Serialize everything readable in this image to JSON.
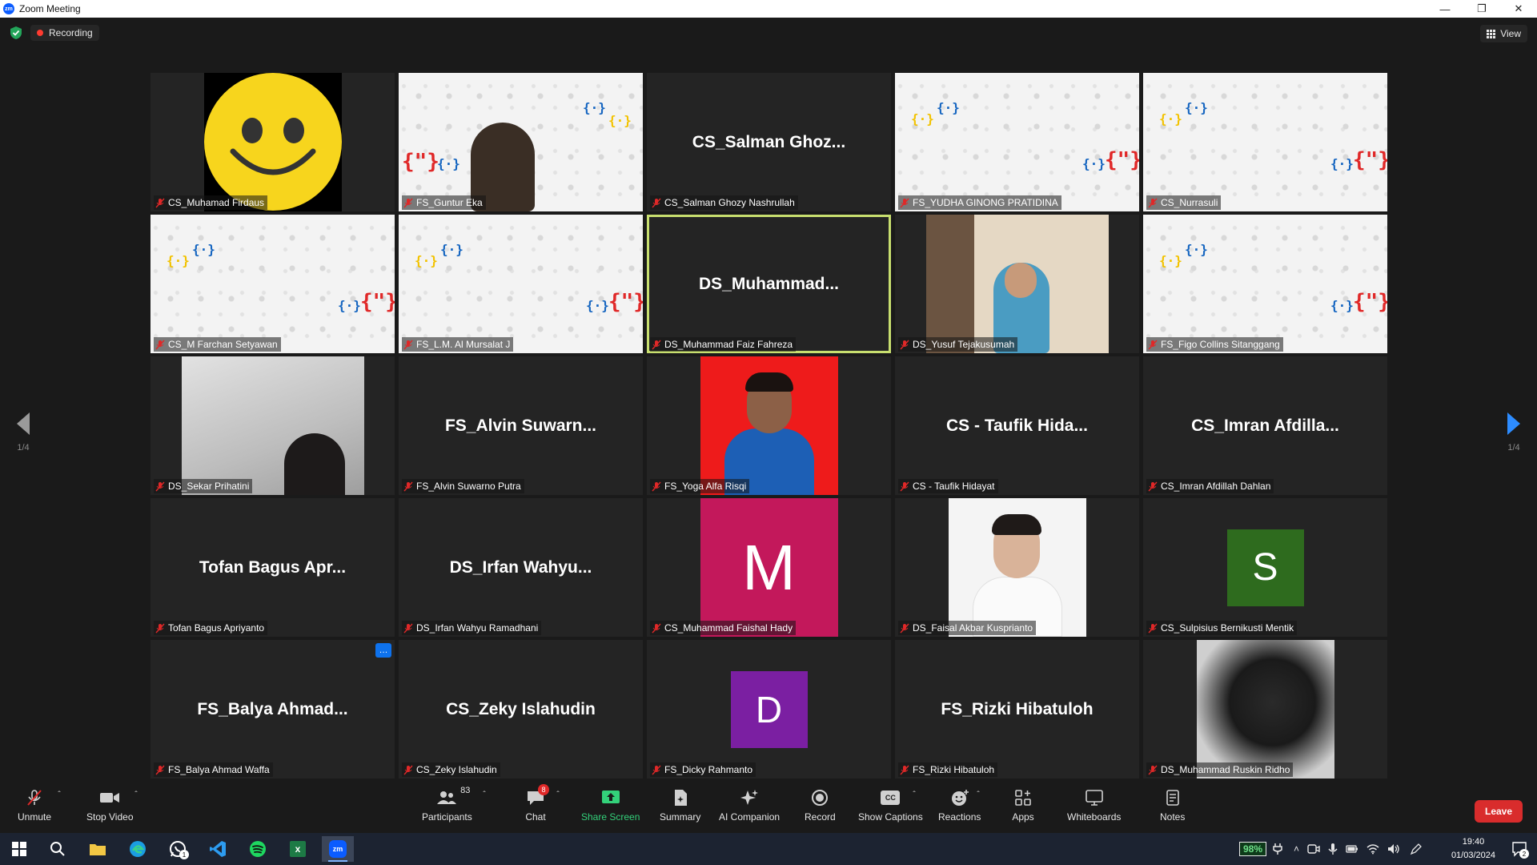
{
  "window": {
    "title": "Zoom Meeting",
    "logo_text": "zm"
  },
  "meeting": {
    "recording_label": "Recording",
    "view_label": "View",
    "page_indicator_left": "1/4",
    "page_indicator_right": "1/4"
  },
  "tiles": [
    {
      "label": "CS_Muhamad Firdaus",
      "big": ""
    },
    {
      "label": "FS_Guntur Eka",
      "big": ""
    },
    {
      "label": "CS_Salman Ghozy Nashrullah",
      "big": "CS_Salman  Ghoz..."
    },
    {
      "label": "FS_YUDHA GINONG PRATIDINA",
      "big": ""
    },
    {
      "label": "CS_Nurrasuli",
      "big": ""
    },
    {
      "label": "CS_M Farchan Setyawan",
      "big": ""
    },
    {
      "label": "FS_L.M. Al Mursalat J",
      "big": ""
    },
    {
      "label": "DS_Muhammad Faiz Fahreza",
      "big": "DS_Muhammad..."
    },
    {
      "label": "DS_Yusuf Tejakusumah",
      "big": ""
    },
    {
      "label": "FS_Figo Collins Sitanggang",
      "big": ""
    },
    {
      "label": "DS_Sekar Prihatini",
      "big": ""
    },
    {
      "label": "FS_Alvin Suwarno Putra",
      "big": "FS_Alvin  Suwarn..."
    },
    {
      "label": "FS_Yoga Alfa Risqi",
      "big": ""
    },
    {
      "label": "CS - Taufik Hidayat",
      "big": "CS - Taufik  Hida..."
    },
    {
      "label": "CS_Imran Afdillah Dahlan",
      "big": "CS_Imran  Afdilla..."
    },
    {
      "label": "Tofan Bagus Apriyanto",
      "big": "Tofan Bagus  Apr..."
    },
    {
      "label": "DS_Irfan Wahyu Ramadhani",
      "big": "DS_Irfan  Wahyu..."
    },
    {
      "label": "CS_Muhammad Faishal Hady",
      "big": "",
      "avatar_letter": "M",
      "avatar_color": "#c3185b"
    },
    {
      "label": "DS_Faisal Akbar Kusprianto",
      "big": ""
    },
    {
      "label": "CS_Sulpisius Bernikusti Mentik",
      "big": "",
      "avatar_letter": "S",
      "avatar_color": "#2e6b1e"
    },
    {
      "label": "FS_Balya Ahmad Waffa",
      "big": "FS_Balya  Ahmad...",
      "more": "…"
    },
    {
      "label": "CS_Zeky Islahudin",
      "big": "CS_Zeky  Islahudin"
    },
    {
      "label": "FS_Dicky Rahmanto",
      "big": "",
      "avatar_letter": "D",
      "avatar_color": "#7b1fa2"
    },
    {
      "label": "FS_Rizki Hibatuloh",
      "big": "FS_Rizki  Hibatuloh"
    },
    {
      "label": "DS_Muhammad Ruskin Ridho",
      "big": ""
    }
  ],
  "toolbar": {
    "unmute": "Unmute",
    "stop_video": "Stop Video",
    "participants": "Participants",
    "participants_count": "83",
    "chat": "Chat",
    "chat_badge": "8",
    "share_screen": "Share Screen",
    "summary": "Summary",
    "ai_companion": "AI Companion",
    "record": "Record",
    "show_captions": "Show Captions",
    "captions_icon_text": "CC",
    "reactions": "Reactions",
    "apps": "Apps",
    "whiteboards": "Whiteboards",
    "notes": "Notes",
    "leave": "Leave"
  },
  "taskbar": {
    "battery": "98%",
    "time": "19:40",
    "date": "01/03/2024",
    "notification_count": "2",
    "whatsapp_badge": "1",
    "excel_letter": "x",
    "zoom_letter": "zm"
  },
  "colors": {
    "accent_green": "#c8df6f",
    "leave_red": "#d92c2c",
    "share_green": "#33d17a",
    "zoom_blue": "#0b5cff"
  }
}
